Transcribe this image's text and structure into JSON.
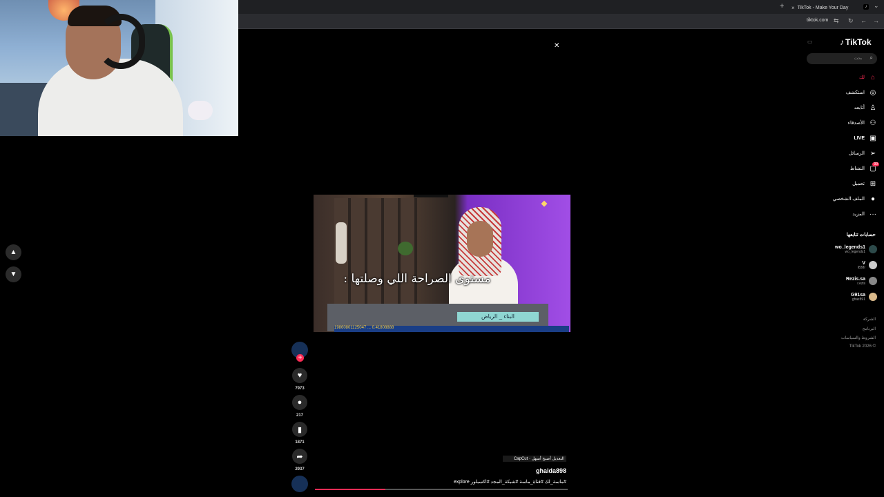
{
  "browser": {
    "tab_title": "TikTok - Make Your Day",
    "new_tab": "+",
    "tab_close": "×",
    "tab_menu": "⌄",
    "url": "tiktok.com"
  },
  "video": {
    "caption": "مستوى الصراحة اللي وصلتها :",
    "lower_third": "البناء _ الرياض",
    "ticker": "19860801125047 ... 0.41808888",
    "progress": 0.28
  },
  "actions": {
    "likes": "7973",
    "comments": "217",
    "saves": "1871",
    "shares": "2937"
  },
  "meta": {
    "source": "CapCut · التعديل أصبح أسهل",
    "username": "ghaida898",
    "hashtags": "#ماسة_لك #قناة_ماسة #شبكة_المجد #اكسبلور explore"
  },
  "sidebar": {
    "logo": "TikTok",
    "search_placeholder": "بحث",
    "nav": [
      {
        "label": "لك",
        "icon": "home-icon"
      },
      {
        "label": "استكشف",
        "icon": "compass-icon"
      },
      {
        "label": "أتابعه",
        "icon": "user-follow-icon"
      },
      {
        "label": "الأصدقاء",
        "icon": "friends-icon"
      },
      {
        "label": "LIVE",
        "icon": "live-icon"
      },
      {
        "label": "الرسائل",
        "icon": "send-icon"
      },
      {
        "label": "النشاط",
        "icon": "inbox-icon",
        "badge": "99"
      },
      {
        "label": "تحميل",
        "icon": "upload-icon"
      },
      {
        "label": "الملف الشخصي",
        "icon": "profile-icon"
      },
      {
        "label": "المزيد",
        "icon": "more-icon"
      }
    ],
    "following_title": "حسابات تتابعها",
    "accounts": [
      {
        "name": "wo_legends1",
        "handle": "wo_legends1"
      },
      {
        "name": "V",
        "handle": "l838r"
      },
      {
        "name": "Rezis.sa",
        "handle": "r.ezis"
      },
      {
        "name": "G91sa",
        "handle": "ghaz891"
      }
    ],
    "footer": [
      "الشركة",
      "البرنامج",
      "الشروط والسياسات",
      "TikTok 2026 ©"
    ]
  }
}
